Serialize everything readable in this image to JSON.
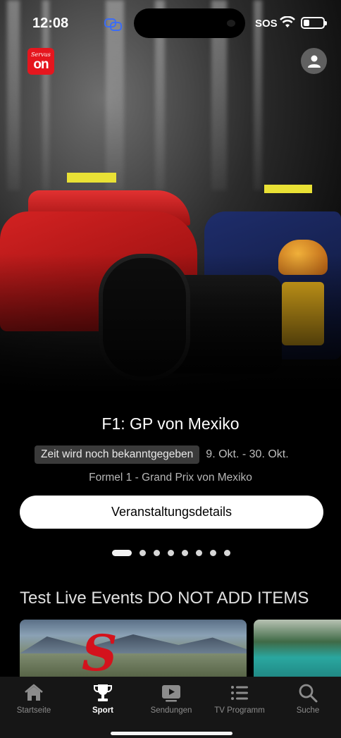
{
  "status_bar": {
    "time": "12:08",
    "sos": "SOS",
    "battery_level": 0.3
  },
  "app": {
    "logo_top": "Servus",
    "logo_main": "on"
  },
  "featured": {
    "title": "F1: GP von Mexiko",
    "time_badge": "Zeit wird noch bekanntgegeben",
    "date_range": "9. Okt. - 30. Okt.",
    "subtitle": "Formel 1 - Grand Prix von Mexiko",
    "details_button": "Veranstaltungsdetails",
    "carousel": {
      "count": 8,
      "active_index": 0
    }
  },
  "section": {
    "title": "Test Live Events DO NOT ADD ITEMS",
    "cards": [
      {
        "script_text": "S"
      },
      {
        "script_text": ""
      }
    ]
  },
  "tabbar": {
    "items": [
      {
        "label": "Startseite",
        "icon": "home-icon",
        "active": false
      },
      {
        "label": "Sport",
        "icon": "trophy-icon",
        "active": true
      },
      {
        "label": "Sendungen",
        "icon": "play-icon",
        "active": false
      },
      {
        "label": "TV Programm",
        "icon": "list-icon",
        "active": false
      },
      {
        "label": "Suche",
        "icon": "search-icon",
        "active": false
      }
    ]
  },
  "colors": {
    "brand_red": "#e5161e",
    "background": "#000000",
    "tabbar": "#161616"
  }
}
